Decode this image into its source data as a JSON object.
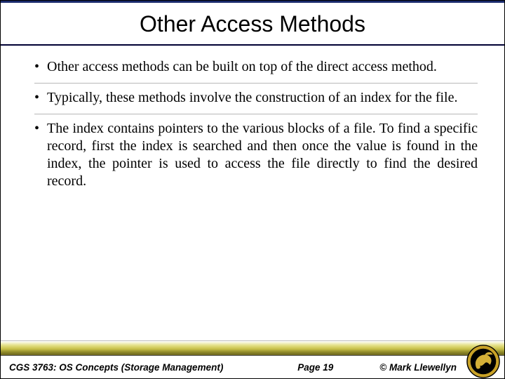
{
  "slide": {
    "title": "Other Access Methods",
    "bullets": [
      "Other access methods can be built on top of the direct access method.",
      "Typically, these methods involve the construction of an index for the file.",
      "The index contains pointers to the various blocks of a file. To find a specific record, first the index is searched and then once the value is found in the index, the pointer is used to access the file directly to find the desired record."
    ]
  },
  "footer": {
    "course": "CGS 3763: OS Concepts (Storage Management)",
    "page": "Page 19",
    "author": "© Mark Llewellyn"
  },
  "icons": {
    "bullet_glyph": "•",
    "logo_name": "ucf-pegasus-seal"
  },
  "colors": {
    "title_rule": "#000033",
    "footer_gold": "#c9c24a"
  }
}
